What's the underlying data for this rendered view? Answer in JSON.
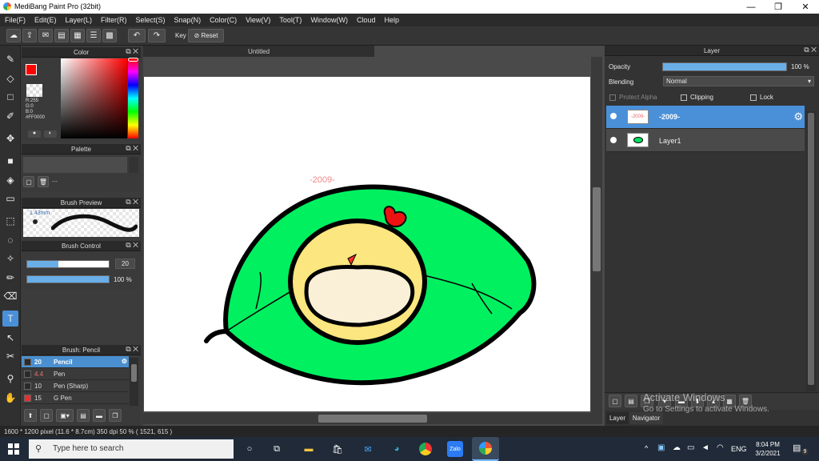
{
  "app": {
    "title": "MediBang Paint Pro (32bit)"
  },
  "menu": [
    "File(F)",
    "Edit(E)",
    "Layer(L)",
    "Filter(R)",
    "Select(S)",
    "Snap(N)",
    "Color(C)",
    "View(V)",
    "Tool(T)",
    "Window(W)",
    "Cloud",
    "Help"
  ],
  "toolbar": {
    "key_label": "Key",
    "reset_label": "Reset"
  },
  "document": {
    "tab_title": "Untitled",
    "signature_text": "-2009-"
  },
  "color_panel": {
    "title": "Color",
    "r": "R:255",
    "g": "G:0",
    "b": "B:0",
    "hex": "#FF0000",
    "current_color": "#ff0000"
  },
  "palette_panel": {
    "title": "Palette",
    "empty_text": "---"
  },
  "brush_preview": {
    "title": "Brush Preview",
    "size_text": "1.43mm"
  },
  "brush_control": {
    "title": "Brush Control",
    "size_value": "20",
    "opacity_value": "100 %",
    "size_fraction": 0.38,
    "opacity_fraction": 1.0
  },
  "brush_list": {
    "title": "Brush: Pencil",
    "items": [
      {
        "size": "20",
        "name": "Pencil",
        "selected": true,
        "color": "#2a2a2a"
      },
      {
        "size": "4.4",
        "name": "Pen",
        "selected": false,
        "color": "#2a2a2a"
      },
      {
        "size": "10",
        "name": "Pen (Sharp)",
        "selected": false,
        "color": "#2a2a2a"
      },
      {
        "size": "15",
        "name": "G Pen",
        "selected": false,
        "color": "#e53030"
      }
    ]
  },
  "layer_panel": {
    "title": "Layer",
    "opacity_label": "Opacity",
    "opacity_value": "100 %",
    "opacity_fraction": 1.0,
    "blending_label": "Blending",
    "blending_value": "Normal",
    "protect_alpha": "Protect Alpha",
    "clipping": "Clipping",
    "lock": "Lock",
    "layers": [
      {
        "name": "-2009-",
        "thumb": "-2009-",
        "selected": true
      },
      {
        "name": "Layer1",
        "selected": false
      }
    ]
  },
  "bottom_tabs": {
    "layer": "Layer",
    "navigator": "Navigator"
  },
  "watermark": {
    "line1": "Activate Windows",
    "line2": "Go to Settings to activate Windows."
  },
  "status": {
    "text": "1600 * 1200 pixel   (11.6 * 8.7cm)   350 dpi   50 %   ( 1521, 615 )"
  },
  "taskbar": {
    "search_placeholder": "Type here to search",
    "time": "8:04 PM",
    "date": "3/2/2021",
    "lang": "ENG",
    "notif_count": "9",
    "zalo_label": "Zalo"
  },
  "icons": [
    "cloud-icon",
    "undo-icon",
    "redo-icon",
    "pencil-icon",
    "eraser-icon",
    "move-icon",
    "fill-icon",
    "text-icon",
    "eyedropper-icon",
    "hand-icon",
    "gear-icon",
    "search-icon",
    "windows-icon"
  ]
}
